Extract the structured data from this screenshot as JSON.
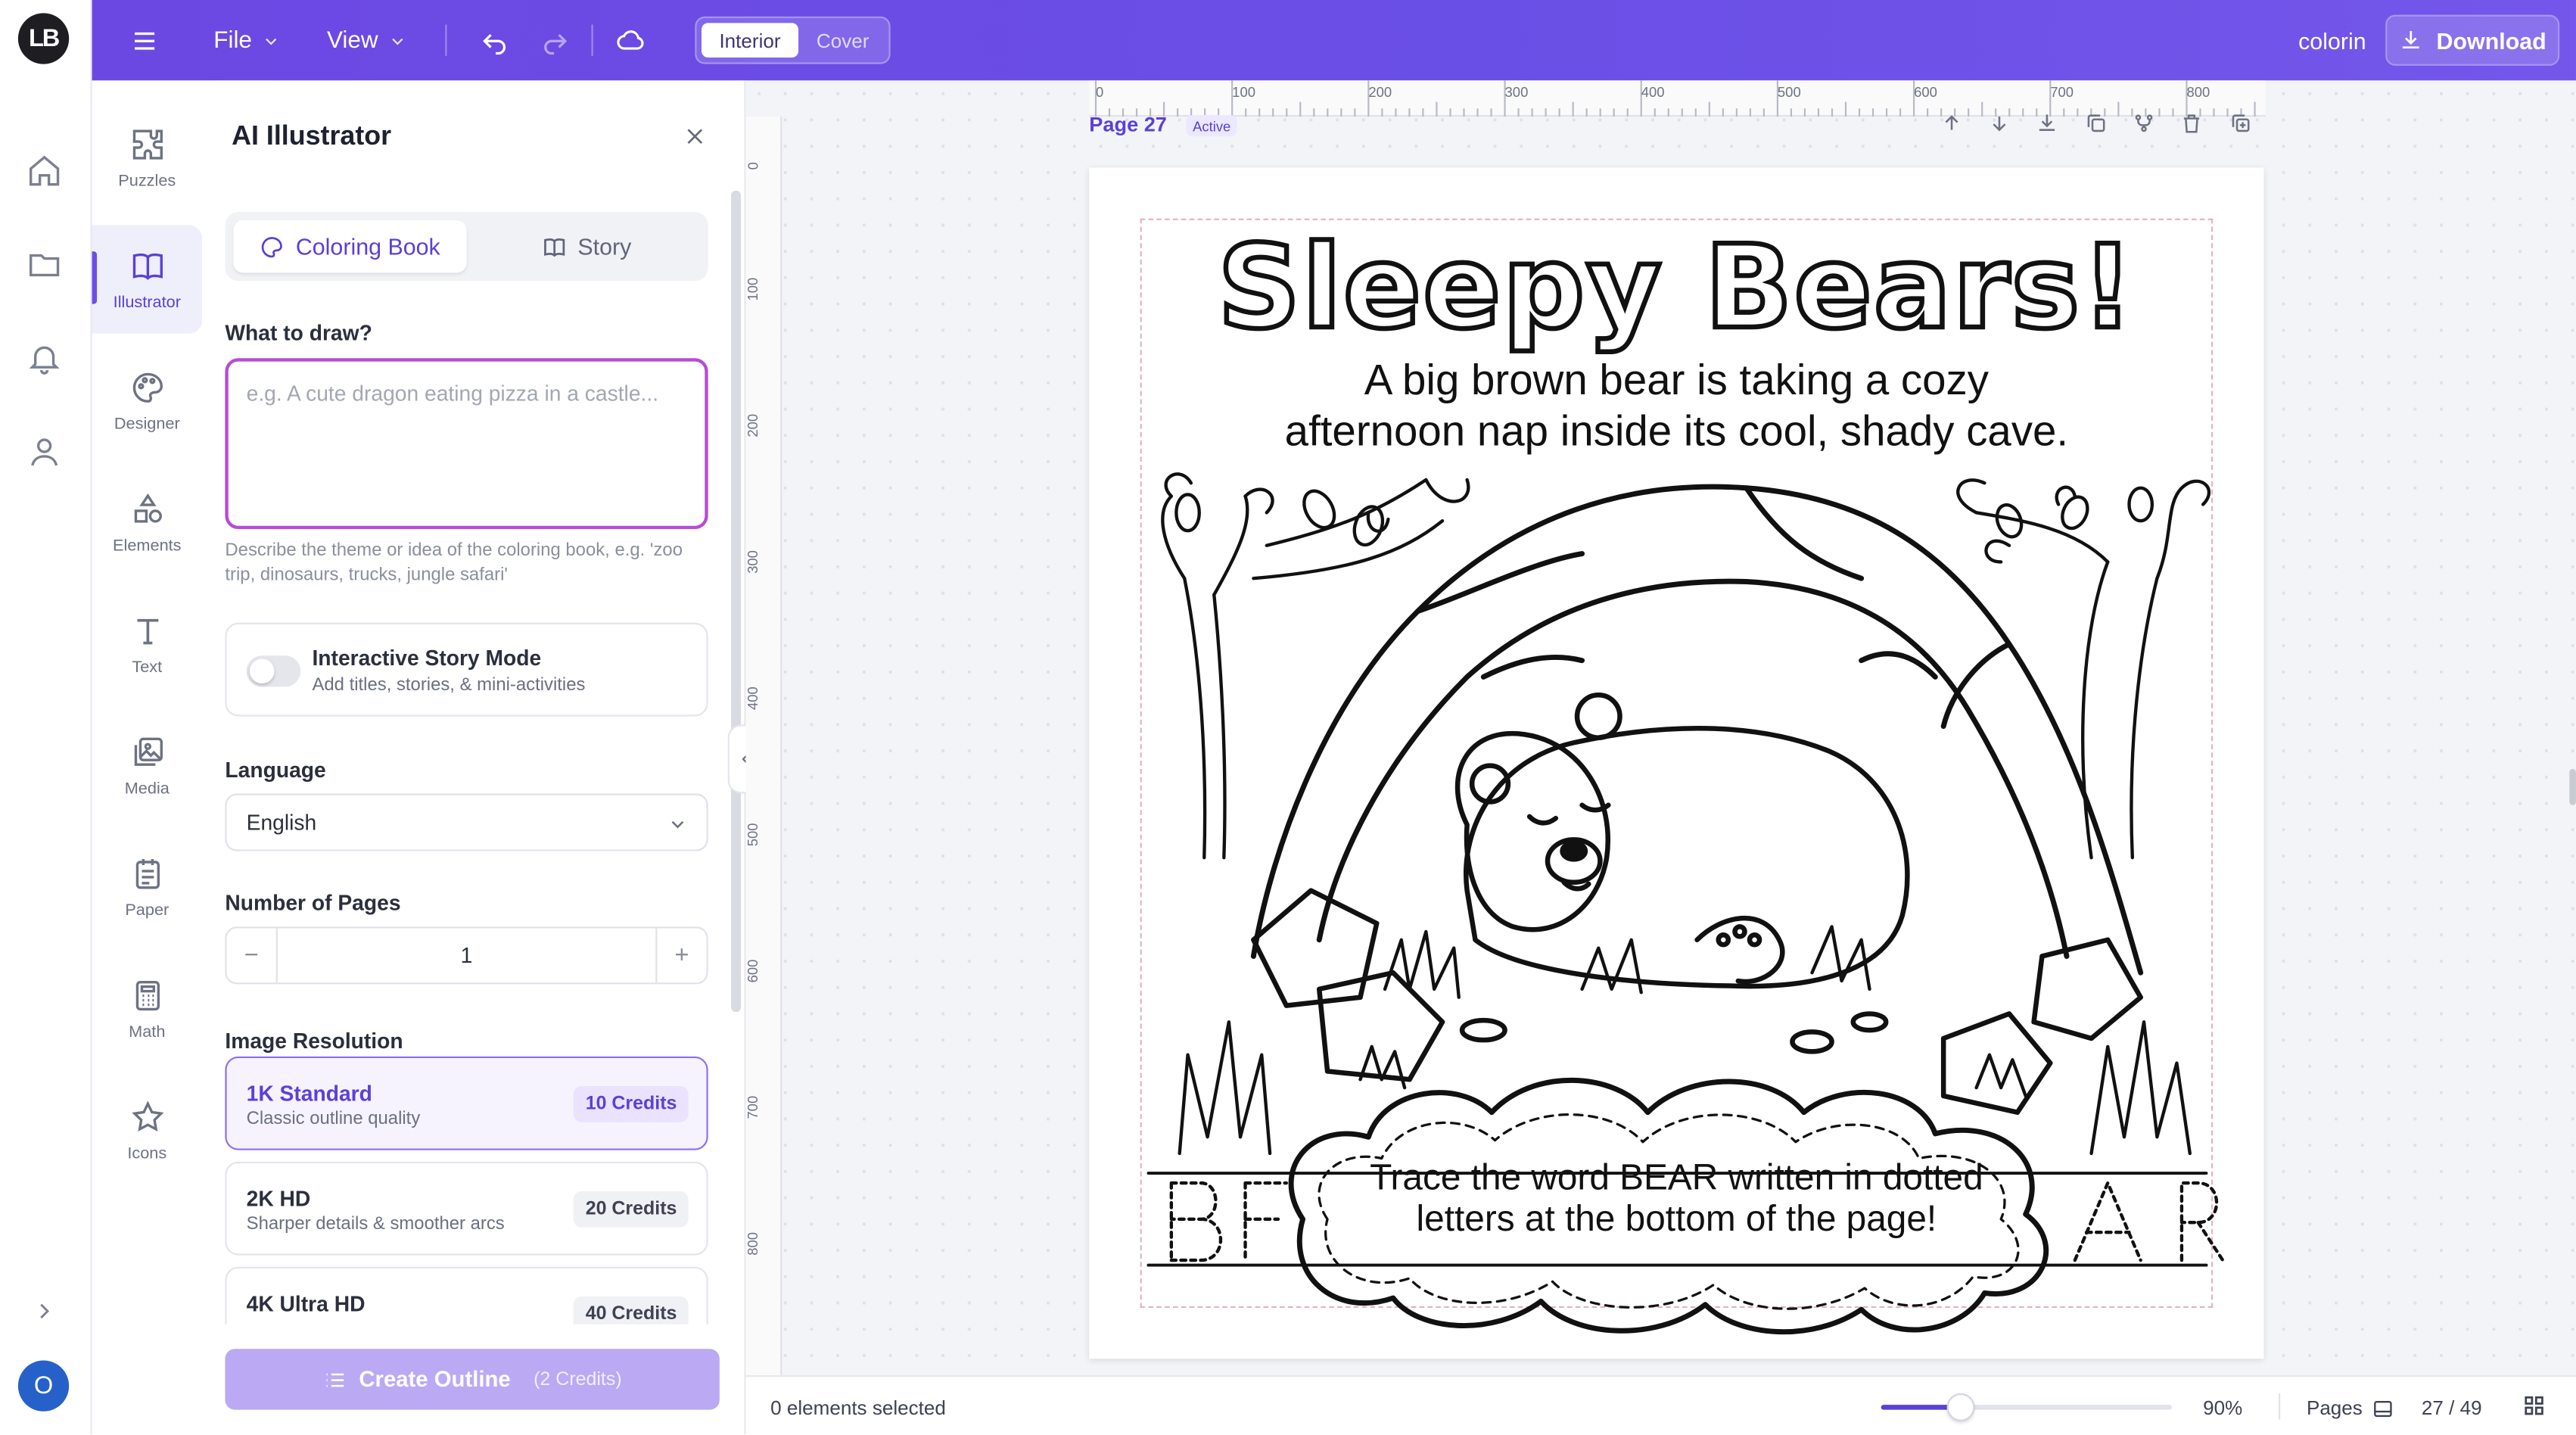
{
  "app": {
    "logo": "LB",
    "avatar_initial": "O"
  },
  "topbar": {
    "menu_icon": "hamburger-icon",
    "file_label": "File",
    "view_label": "View",
    "seg_interior": "Interior",
    "seg_cover": "Cover",
    "project_name": "colorin",
    "download_label": "Download"
  },
  "rail": {
    "items": [
      "home-icon",
      "folder-icon",
      "bell-icon",
      "user-icon"
    ]
  },
  "tools": [
    {
      "label": "Puzzles",
      "icon": "puzzle-icon"
    },
    {
      "label": "Illustrator",
      "icon": "book-icon",
      "active": true
    },
    {
      "label": "Designer",
      "icon": "palette-icon"
    },
    {
      "label": "Elements",
      "icon": "shapes-icon"
    },
    {
      "label": "Text",
      "icon": "text-icon"
    },
    {
      "label": "Media",
      "icon": "image-icon"
    },
    {
      "label": "Paper",
      "icon": "paper-icon"
    },
    {
      "label": "Math",
      "icon": "calculator-icon"
    },
    {
      "label": "Icons",
      "icon": "star-icon"
    }
  ],
  "panel": {
    "title": "AI Illustrator",
    "tab_coloring": "Coloring Book",
    "tab_story": "Story",
    "draw_label": "What to draw?",
    "draw_placeholder": "e.g. A cute dragon eating pizza in a castle...",
    "draw_hint": "Describe the theme or idea of the coloring book, e.g. 'zoo trip, dinosaurs, trucks, jungle safari'",
    "story_mode_title": "Interactive Story Mode",
    "story_mode_sub": "Add titles, stories, & mini-activities",
    "language_label": "Language",
    "language_value": "English",
    "pages_label": "Number of Pages",
    "pages_value": "1",
    "resolution_label": "Image Resolution",
    "resolutions": [
      {
        "title": "1K Standard",
        "sub": "Classic outline quality",
        "credits": "10 Credits",
        "selected": true
      },
      {
        "title": "2K HD",
        "sub": "Sharper details & smoother arcs",
        "credits": "20 Credits"
      },
      {
        "title": "4K Ultra HD",
        "sub": "",
        "credits": "40 Credits"
      }
    ],
    "create_label": "Create Outline",
    "create_credits": "(2 Credits)"
  },
  "canvas": {
    "ruler_top": [
      "0",
      "100",
      "200",
      "300",
      "400",
      "500",
      "600",
      "700",
      "800"
    ],
    "ruler_left": [
      "0",
      "100",
      "200",
      "300",
      "400",
      "500",
      "600",
      "700",
      "800"
    ],
    "page_label": "Page 27",
    "page_badge": "Active",
    "page_tools": [
      "arrow-up-icon",
      "arrow-down-icon",
      "download-icon",
      "duplicate-icon",
      "branch-icon",
      "trash-icon",
      "add-page-icon"
    ],
    "artwork": {
      "title": "Sleepy Bears!",
      "subtitle_line1": "A big brown bear is taking a cozy",
      "subtitle_line2": "afternoon nap inside its cool, shady cave.",
      "cloud_line1": "Trace the word BEAR written in dotted",
      "cloud_line2": "letters at the bottom of the page!",
      "trace_word": "BEAR"
    }
  },
  "status": {
    "selection": "0 elements selected",
    "zoom": "90%",
    "zoom_fraction": 0.27,
    "pages_label": "Pages",
    "page_count": "27 / 49"
  }
}
